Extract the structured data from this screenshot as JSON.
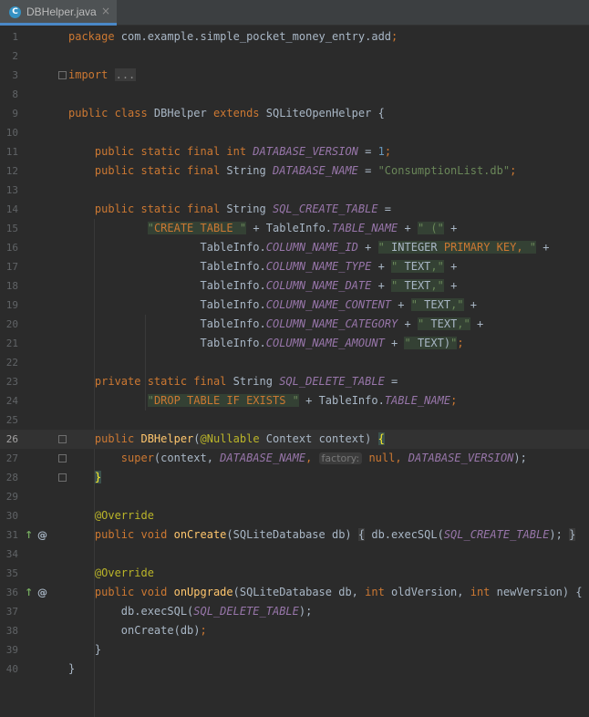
{
  "tab": {
    "file_name": "DBHelper.java",
    "icon_letter": "C",
    "close_label": "×"
  },
  "editor": {
    "current_line": "26",
    "lines": [
      {
        "n": "1",
        "tokens": [
          {
            "t": "package",
            "c": "kw"
          },
          {
            "t": " com.example.simple_pocket_money_entry.add",
            "c": ""
          },
          {
            "t": ";",
            "c": "kw"
          }
        ]
      },
      {
        "n": "2",
        "tokens": []
      },
      {
        "n": "3",
        "tokens": [
          {
            "t": "import",
            "c": "kw"
          },
          {
            "t": " ",
            "c": ""
          },
          {
            "t": "...",
            "c": "fold"
          }
        ]
      },
      {
        "n": "8",
        "tokens": []
      },
      {
        "n": "9",
        "tokens": [
          {
            "t": "public class ",
            "c": "kw"
          },
          {
            "t": "DBHelper ",
            "c": ""
          },
          {
            "t": "extends ",
            "c": "kw"
          },
          {
            "t": "SQLiteOpenHelper {",
            "c": ""
          }
        ]
      },
      {
        "n": "10",
        "tokens": []
      },
      {
        "n": "11",
        "tokens": [
          {
            "t": "    public static final int ",
            "c": "kw"
          },
          {
            "t": "DATABASE_VERSION",
            "c": "cst"
          },
          {
            "t": " = ",
            "c": ""
          },
          {
            "t": "1",
            "c": "num"
          },
          {
            "t": ";",
            "c": "kw"
          }
        ]
      },
      {
        "n": "12",
        "tokens": [
          {
            "t": "    public static final ",
            "c": "kw"
          },
          {
            "t": "String ",
            "c": ""
          },
          {
            "t": "DATABASE_NAME",
            "c": "cst"
          },
          {
            "t": " = ",
            "c": ""
          },
          {
            "t": "\"ConsumptionList.db\"",
            "c": "str"
          },
          {
            "t": ";",
            "c": "kw"
          }
        ]
      },
      {
        "n": "13",
        "tokens": []
      },
      {
        "n": "14",
        "tokens": [
          {
            "t": "    public static final ",
            "c": "kw"
          },
          {
            "t": "String ",
            "c": ""
          },
          {
            "t": "SQL_CREATE_TABLE",
            "c": "cst"
          },
          {
            "t": " =",
            "c": ""
          }
        ]
      },
      {
        "n": "15",
        "tokens": [
          {
            "t": "            ",
            "c": ""
          },
          {
            "t": "\"",
            "c": "str hl"
          },
          {
            "t": "CREATE TABLE",
            "c": "kw hl"
          },
          {
            "t": " \"",
            "c": "str hl"
          },
          {
            "t": " + TableInfo.",
            "c": ""
          },
          {
            "t": "TABLE_NAME",
            "c": "cst"
          },
          {
            "t": " + ",
            "c": ""
          },
          {
            "t": "\" (\"",
            "c": "str hl"
          },
          {
            "t": " +",
            "c": ""
          }
        ]
      },
      {
        "n": "16",
        "tokens": [
          {
            "t": "                    TableInfo.",
            "c": ""
          },
          {
            "t": "COLUMN_NAME_ID",
            "c": "cst"
          },
          {
            "t": " + ",
            "c": ""
          },
          {
            "t": "\"",
            "c": "str hl"
          },
          {
            "t": " INTEGER ",
            "c": "hl"
          },
          {
            "t": "PRIMARY KEY,",
            "c": "kw hl"
          },
          {
            "t": " \"",
            "c": "str hl"
          },
          {
            "t": " +",
            "c": ""
          }
        ]
      },
      {
        "n": "17",
        "tokens": [
          {
            "t": "                    TableInfo.",
            "c": ""
          },
          {
            "t": "COLUMN_NAME_TYPE",
            "c": "cst"
          },
          {
            "t": " + ",
            "c": ""
          },
          {
            "t": "\"",
            "c": "str hl"
          },
          {
            "t": " TEXT",
            "c": "hl"
          },
          {
            "t": ",\"",
            "c": "str hl"
          },
          {
            "t": " +",
            "c": ""
          }
        ]
      },
      {
        "n": "18",
        "tokens": [
          {
            "t": "                    TableInfo.",
            "c": ""
          },
          {
            "t": "COLUMN_NAME_DATE",
            "c": "cst"
          },
          {
            "t": " + ",
            "c": ""
          },
          {
            "t": "\"",
            "c": "str hl"
          },
          {
            "t": " TEXT",
            "c": "hl"
          },
          {
            "t": ",\"",
            "c": "str hl"
          },
          {
            "t": " +",
            "c": ""
          }
        ]
      },
      {
        "n": "19",
        "tokens": [
          {
            "t": "                    TableInfo.",
            "c": ""
          },
          {
            "t": "COLUMN_NAME_CONTENT",
            "c": "cst"
          },
          {
            "t": " + ",
            "c": ""
          },
          {
            "t": "\"",
            "c": "str hl"
          },
          {
            "t": " TEXT",
            "c": "hl"
          },
          {
            "t": ",\"",
            "c": "str hl"
          },
          {
            "t": " +",
            "c": ""
          }
        ]
      },
      {
        "n": "20",
        "tokens": [
          {
            "t": "                    TableInfo.",
            "c": ""
          },
          {
            "t": "COLUMN_NAME_CATEGORY",
            "c": "cst"
          },
          {
            "t": " + ",
            "c": ""
          },
          {
            "t": "\"",
            "c": "str hl"
          },
          {
            "t": " TEXT",
            "c": "hl"
          },
          {
            "t": ",\"",
            "c": "str hl"
          },
          {
            "t": " +",
            "c": ""
          }
        ]
      },
      {
        "n": "21",
        "tokens": [
          {
            "t": "                    TableInfo.",
            "c": ""
          },
          {
            "t": "COLUMN_NAME_AMOUNT",
            "c": "cst"
          },
          {
            "t": " + ",
            "c": ""
          },
          {
            "t": "\"",
            "c": "str hl"
          },
          {
            "t": " TEXT)",
            "c": "hl"
          },
          {
            "t": "\"",
            "c": "str hl"
          },
          {
            "t": ";",
            "c": "kw"
          }
        ]
      },
      {
        "n": "22",
        "tokens": []
      },
      {
        "n": "23",
        "tokens": [
          {
            "t": "    private static final ",
            "c": "kw"
          },
          {
            "t": "String ",
            "c": ""
          },
          {
            "t": "SQL_DELETE_TABLE",
            "c": "cst"
          },
          {
            "t": " =",
            "c": ""
          }
        ]
      },
      {
        "n": "24",
        "tokens": [
          {
            "t": "            ",
            "c": ""
          },
          {
            "t": "\"",
            "c": "str hl"
          },
          {
            "t": "DROP TABLE IF EXISTS",
            "c": "kw hl"
          },
          {
            "t": " \"",
            "c": "str hl"
          },
          {
            "t": " + TableInfo.",
            "c": ""
          },
          {
            "t": "TABLE_NAME",
            "c": "cst"
          },
          {
            "t": ";",
            "c": "kw"
          }
        ]
      },
      {
        "n": "25",
        "tokens": []
      },
      {
        "n": "26",
        "tokens": [
          {
            "t": "    public ",
            "c": "kw"
          },
          {
            "t": "DBHelper",
            "c": "mth"
          },
          {
            "t": "(",
            "c": ""
          },
          {
            "t": "@Nullable",
            "c": "ann"
          },
          {
            "t": " Context context) ",
            "c": ""
          },
          {
            "t": "{",
            "c": "bmatch"
          }
        ]
      },
      {
        "n": "27",
        "tokens": [
          {
            "t": "        ",
            "c": ""
          },
          {
            "t": "super",
            "c": "kw"
          },
          {
            "t": "(context, ",
            "c": ""
          },
          {
            "t": "DATABASE_NAME",
            "c": "cst"
          },
          {
            "t": ", ",
            "c": "kw"
          },
          {
            "t": "factory:",
            "c": "hintbox"
          },
          {
            "t": " ",
            "c": ""
          },
          {
            "t": "null",
            "c": "kw"
          },
          {
            "t": ", ",
            "c": "kw"
          },
          {
            "t": "DATABASE_VERSION",
            "c": "cst"
          },
          {
            "t": ");",
            "c": ""
          }
        ]
      },
      {
        "n": "28",
        "tokens": [
          {
            "t": "    ",
            "c": ""
          },
          {
            "t": "}",
            "c": "bmatch"
          }
        ]
      },
      {
        "n": "29",
        "tokens": []
      },
      {
        "n": "30",
        "tokens": [
          {
            "t": "    ",
            "c": ""
          },
          {
            "t": "@Override",
            "c": "ann"
          }
        ]
      },
      {
        "n": "31",
        "tokens": [
          {
            "t": "    public void ",
            "c": "kw"
          },
          {
            "t": "onCreate",
            "c": "mth"
          },
          {
            "t": "(SQLiteDatabase db) ",
            "c": ""
          },
          {
            "t": "{",
            "c": "brace"
          },
          {
            "t": " db.execSQL(",
            "c": ""
          },
          {
            "t": "SQL_CREATE_TABLE",
            "c": "cst"
          },
          {
            "t": "); ",
            "c": ""
          },
          {
            "t": "}",
            "c": "brace"
          }
        ]
      },
      {
        "n": "34",
        "tokens": []
      },
      {
        "n": "35",
        "tokens": [
          {
            "t": "    ",
            "c": ""
          },
          {
            "t": "@Override",
            "c": "ann"
          }
        ]
      },
      {
        "n": "36",
        "tokens": [
          {
            "t": "    public void ",
            "c": "kw"
          },
          {
            "t": "onUpgrade",
            "c": "mth"
          },
          {
            "t": "(SQLiteDatabase db, ",
            "c": ""
          },
          {
            "t": "int ",
            "c": "kw"
          },
          {
            "t": "oldVersion, ",
            "c": ""
          },
          {
            "t": "int ",
            "c": "kw"
          },
          {
            "t": "newVersion) {",
            "c": ""
          }
        ]
      },
      {
        "n": "37",
        "tokens": [
          {
            "t": "        db.execSQL(",
            "c": ""
          },
          {
            "t": "SQL_DELETE_TABLE",
            "c": "cst"
          },
          {
            "t": ");",
            "c": ""
          }
        ]
      },
      {
        "n": "38",
        "tokens": [
          {
            "t": "        onCreate(db)",
            "c": ""
          },
          {
            "t": ";",
            "c": "kw"
          }
        ]
      },
      {
        "n": "39",
        "tokens": [
          {
            "t": "    }",
            "c": ""
          }
        ]
      },
      {
        "n": "40",
        "tokens": [
          {
            "t": "}",
            "c": ""
          }
        ]
      }
    ]
  },
  "gutter": {
    "override_icon": "override-arrow-icon",
    "annotation_icon": "at-annotation-icon",
    "fold_icon": "fold-marker-icon",
    "override_color": "#73A75E"
  },
  "theme": {
    "background": "#2B2B2B",
    "keyword": "#CC7832",
    "string": "#6A8759",
    "constant": "#9876AA",
    "method": "#FFC66D",
    "annotation": "#BBB529",
    "number": "#6897BB"
  }
}
